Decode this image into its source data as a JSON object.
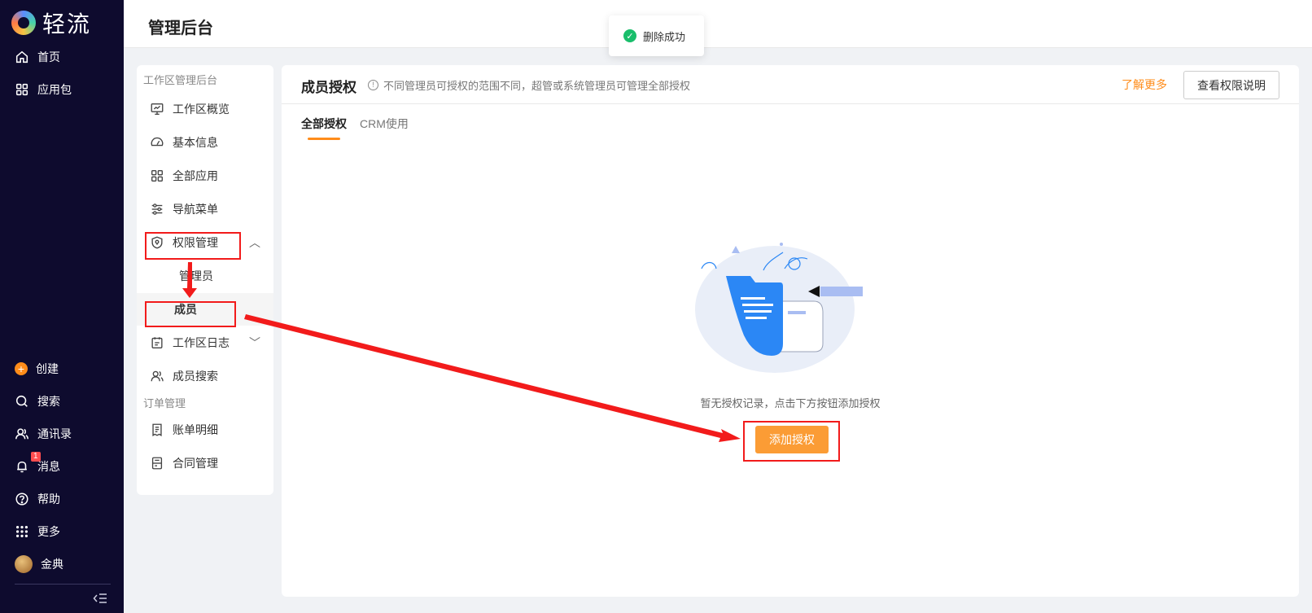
{
  "app": {
    "logo_text": "轻流"
  },
  "leftnav": {
    "top_items": [
      {
        "label": "首页",
        "icon": "home-icon"
      },
      {
        "label": "应用包",
        "icon": "apps-grid-icon"
      }
    ],
    "bottom_items": [
      {
        "label": "创建",
        "icon": "plus-circle-icon"
      },
      {
        "label": "搜索",
        "icon": "search-icon"
      },
      {
        "label": "通讯录",
        "icon": "contacts-icon"
      },
      {
        "label": "消息",
        "icon": "bell-icon",
        "badge": "1"
      },
      {
        "label": "帮助",
        "icon": "help-icon"
      },
      {
        "label": "更多",
        "icon": "dots-grid-icon"
      },
      {
        "label": "金典",
        "icon": "avatar"
      }
    ],
    "collapse_icon": "collapse-icon"
  },
  "header": {
    "title": "管理后台"
  },
  "toast": {
    "text": "删除成功",
    "icon": "check-circle-icon",
    "color": "#19be6b"
  },
  "subsidebar": {
    "group1_title": "工作区管理后台",
    "items": [
      {
        "label": "工作区概览",
        "icon": "monitor-icon"
      },
      {
        "label": "基本信息",
        "icon": "dashboard-icon"
      },
      {
        "label": "全部应用",
        "icon": "apps-grid-icon"
      },
      {
        "label": "导航菜单",
        "icon": "sliders-icon"
      },
      {
        "label": "权限管理",
        "icon": "shield-icon",
        "expanded": true
      },
      {
        "label": "工作区日志",
        "icon": "calendar-icon",
        "expanded": false
      },
      {
        "label": "成员搜索",
        "icon": "users-icon"
      }
    ],
    "children": [
      {
        "label": "管理员"
      },
      {
        "label": "成员",
        "active": true
      }
    ],
    "group2_title": "订单管理",
    "group2_items": [
      {
        "label": "账单明细",
        "icon": "bill-icon"
      },
      {
        "label": "合同管理",
        "icon": "contract-icon"
      }
    ]
  },
  "panel": {
    "title": "成员授权",
    "tip": "不同管理员可授权的范围不同，超管或系统管理员可管理全部授权",
    "learn_more": "了解更多",
    "view_button": "查看权限说明",
    "tabs": [
      {
        "label": "全部授权",
        "active": true
      },
      {
        "label": "CRM使用",
        "active": false
      }
    ],
    "empty_text": "暂无授权记录，点击下方按钮添加授权",
    "add_button": "添加授权"
  },
  "colors": {
    "accent": "#ff8c1a",
    "nav_bg": "#0e0b2e",
    "annotation": "#f21b1b"
  }
}
